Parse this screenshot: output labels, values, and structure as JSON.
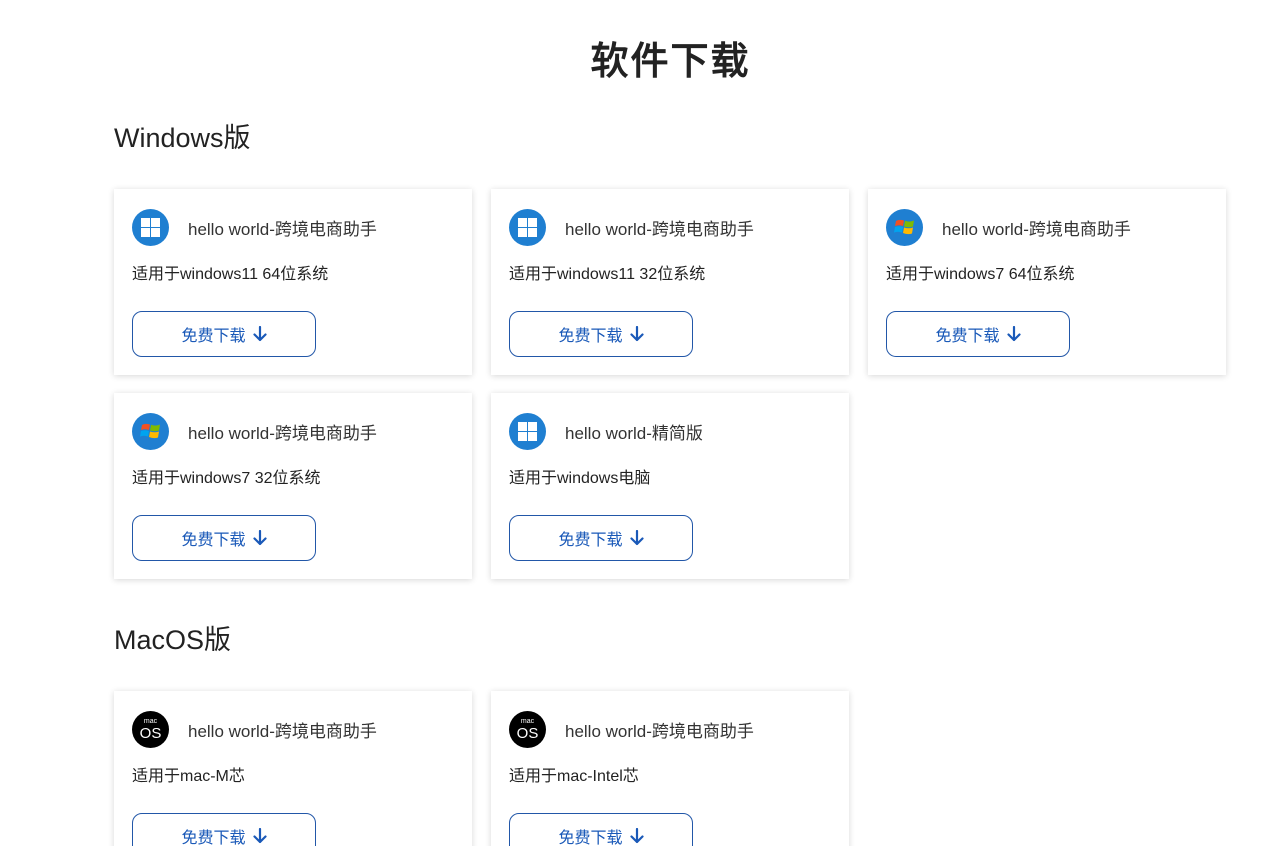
{
  "page_title": "软件下载",
  "sections": [
    {
      "title": "Windows版",
      "cards": [
        {
          "icon": "windows11-icon",
          "name": "hello world-跨境电商助手",
          "desc": "适用于windows11 64位系统",
          "button": "免费下载"
        },
        {
          "icon": "windows11-icon",
          "name": "hello world-跨境电商助手",
          "desc": "适用于windows11 32位系统",
          "button": "免费下载"
        },
        {
          "icon": "windows7-icon",
          "name": "hello world-跨境电商助手",
          "desc": "适用于windows7 64位系统",
          "button": "免费下载"
        },
        {
          "icon": "windows7-icon",
          "name": "hello world-跨境电商助手",
          "desc": "适用于windows7 32位系统",
          "button": "免费下载"
        },
        {
          "icon": "windows11-icon",
          "name": "hello world-精简版",
          "desc": "适用于windows电脑",
          "button": "免费下载"
        }
      ]
    },
    {
      "title": "MacOS版",
      "cards": [
        {
          "icon": "macos-icon",
          "icon_small": "mac",
          "icon_big": "OS",
          "name": "hello world-跨境电商助手",
          "desc": "适用于mac-M芯",
          "button": "免费下载"
        },
        {
          "icon": "macos-icon",
          "icon_small": "mac",
          "icon_big": "OS",
          "name": "hello world-跨境电商助手",
          "desc": "适用于mac-Intel芯",
          "button": "免费下载"
        }
      ]
    }
  ],
  "colors": {
    "accent": "#1a59b8",
    "button_border": "#2257a8",
    "win_icon_bg": "#1f7fd1",
    "mac_icon_bg": "#000000"
  }
}
